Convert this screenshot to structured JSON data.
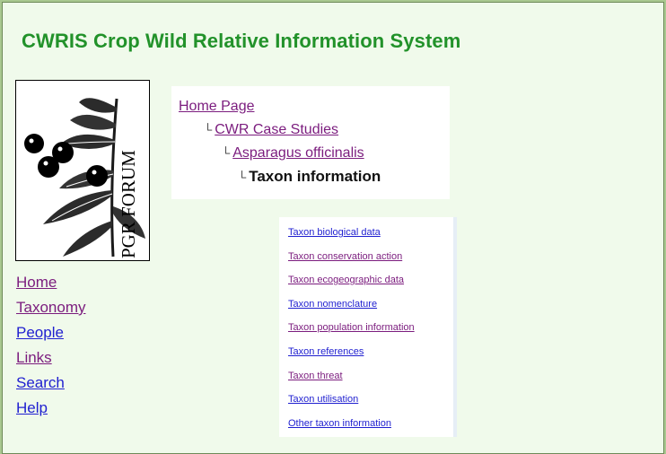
{
  "site": {
    "title": "CWRIS Crop Wild Relative Information System"
  },
  "logo": {
    "text": "PGR FORUM"
  },
  "sidebar": {
    "items": [
      {
        "label": "Home",
        "visited": true
      },
      {
        "label": "Taxonomy",
        "visited": true
      },
      {
        "label": "People",
        "visited": false
      },
      {
        "label": "Links",
        "visited": true
      },
      {
        "label": "Search",
        "visited": false
      },
      {
        "label": "Help",
        "visited": false
      }
    ]
  },
  "breadcrumb": {
    "items": [
      {
        "label": "Home Page",
        "level": 0
      },
      {
        "label": "CWR Case Studies",
        "level": 1
      },
      {
        "label": "Asparagus officinalis",
        "level": 2
      }
    ],
    "current": {
      "label": "Taxon information",
      "level": 3
    },
    "level_mark": "└"
  },
  "taxon_links": [
    {
      "label": "Taxon biological data",
      "visited": false
    },
    {
      "label": "Taxon conservation action",
      "visited": true
    },
    {
      "label": "Taxon ecogeographic data",
      "visited": true
    },
    {
      "label": "Taxon nomenclature",
      "visited": false
    },
    {
      "label": "Taxon population information",
      "visited": true
    },
    {
      "label": "Taxon references",
      "visited": false
    },
    {
      "label": "Taxon threat",
      "visited": true
    },
    {
      "label": "Taxon utilisation",
      "visited": false
    },
    {
      "label": "Other taxon information",
      "visited": false
    }
  ],
  "colors": {
    "title_green": "#22922A",
    "link_blue": "#1F1FD0",
    "link_visited": "#7B1C7E",
    "page_bg": "#F0FAEB",
    "outer_bg": "#A9C890"
  }
}
